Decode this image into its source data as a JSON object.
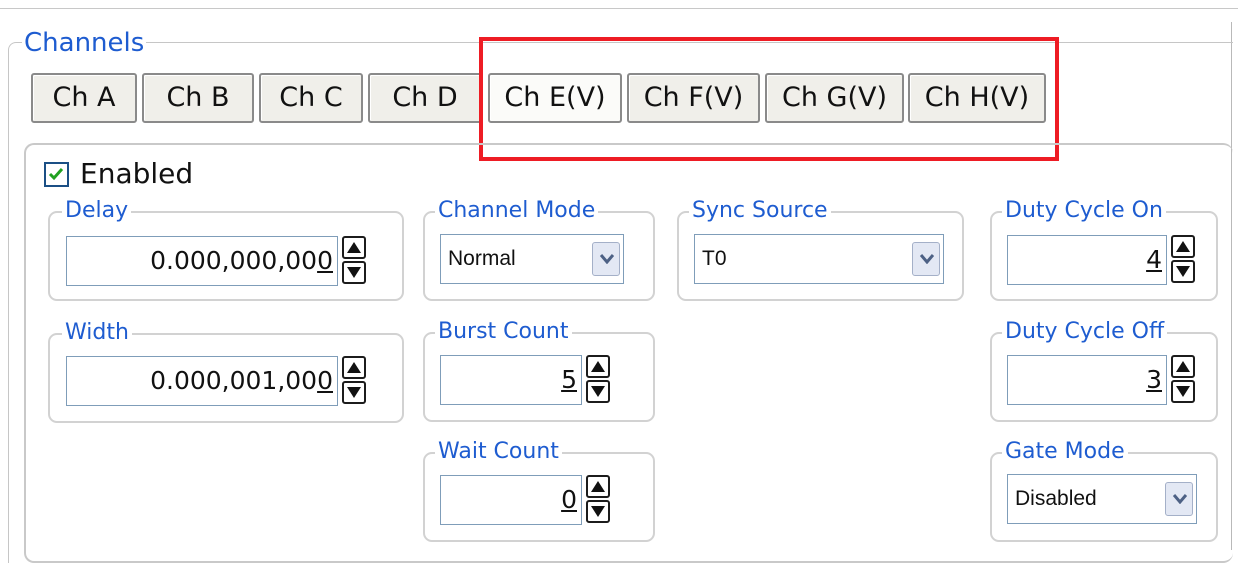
{
  "channels": {
    "legend": "Channels",
    "tabs": [
      {
        "label": "Ch A",
        "selected": false
      },
      {
        "label": "Ch B",
        "selected": false
      },
      {
        "label": "Ch C",
        "selected": false
      },
      {
        "label": "Ch D",
        "selected": false
      },
      {
        "label": "Ch E(V)",
        "selected": true
      },
      {
        "label": "Ch F(V)",
        "selected": false
      },
      {
        "label": "Ch G(V)",
        "selected": false
      },
      {
        "label": "Ch H(V)",
        "selected": false
      }
    ],
    "highlight_color": "#ee1c24"
  },
  "panel": {
    "enabled": {
      "label": "Enabled",
      "checked": true
    },
    "delay": {
      "label": "Delay",
      "value_main": "0.000,000,00",
      "value_last": "0"
    },
    "width": {
      "label": "Width",
      "value_main": "0.000,001,00",
      "value_last": "0"
    },
    "channel_mode": {
      "label": "Channel Mode",
      "value": "Normal"
    },
    "burst_count": {
      "label": "Burst Count",
      "value": "5"
    },
    "wait_count": {
      "label": "Wait Count",
      "value": "0"
    },
    "sync_source": {
      "label": "Sync Source",
      "value": "T0"
    },
    "duty_cycle_on": {
      "label": "Duty Cycle On",
      "value": "4"
    },
    "duty_cycle_off": {
      "label": "Duty Cycle Off",
      "value": "3"
    },
    "gate_mode": {
      "label": "Gate Mode",
      "value": "Disabled"
    }
  },
  "icons": [
    "checkmark-icon",
    "spin-up-icon",
    "spin-down-icon",
    "chevron-down-icon"
  ],
  "colors": {
    "label_blue": "#1e5cd0",
    "border_grey": "#d2d2d2",
    "field_border": "#7f9db9"
  }
}
